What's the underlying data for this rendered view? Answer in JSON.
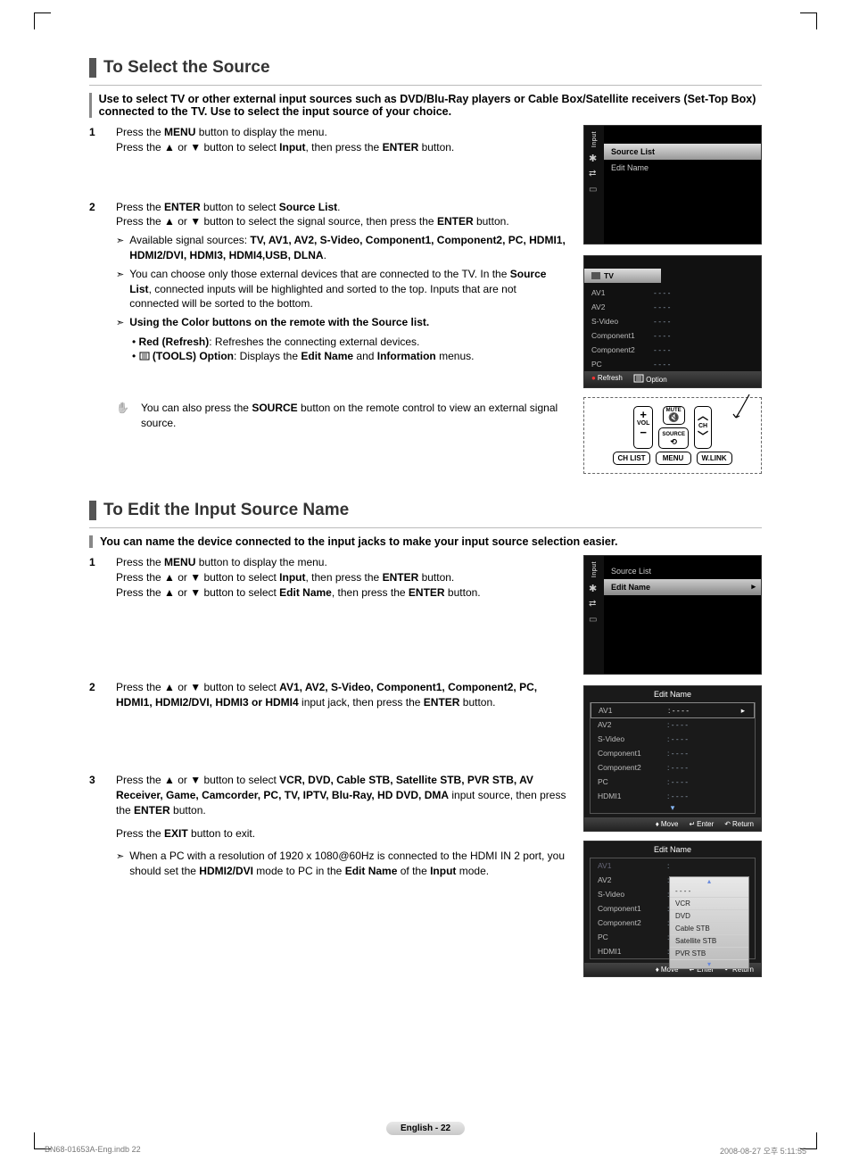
{
  "section1": {
    "heading": "To Select the Source",
    "intro": "Use to select TV or other external input sources such as DVD/Blu-Ray players or Cable Box/Satellite receivers (Set-Top Box) connected to the TV. Use to select the input source of your choice.",
    "step1_a": "Press the ",
    "step1_menu": "MENU",
    "step1_b": " button to display the menu.",
    "step1_c": "Press the ▲ or ▼ button to select ",
    "step1_input": "Input",
    "step1_d": ", then press the ",
    "step1_enter": "ENTER",
    "step1_e": " button.",
    "step2_a": "Press the ",
    "step2_enter1": "ENTER",
    "step2_b": " button to select ",
    "step2_sl": "Source List",
    "step2_c": ".",
    "step2_d": "Press the ▲ or ▼ button to select the signal source, then press the ",
    "step2_enter2": "ENTER",
    "step2_e": " button.",
    "arrow1_a": "Available signal sources: ",
    "arrow1_sources": "TV, AV1, AV2, S-Video, Component1, Component2, PC, HDMI1, HDMI2/DVI, HDMI3, HDMI4,USB, DLNA",
    "arrow1_b": ".",
    "arrow2_a": "You can choose only those external devices that are connected to the TV. In the ",
    "arrow2_sl": "Source List",
    "arrow2_b": ", connected inputs will be highlighted and sorted to the top. Inputs that are not connected will be sorted to the bottom.",
    "arrow3": "Using the Color buttons on the remote with the Source list.",
    "sub_red_label": "Red (Refresh)",
    "sub_red_text": ": Refreshes the connecting external devices.",
    "sub_tools_label": "(TOOLS) Option",
    "sub_tools_a": ": Displays the ",
    "sub_tools_edit": "Edit Name",
    "sub_tools_b": " and ",
    "sub_tools_info": "Information",
    "sub_tools_c": " menus.",
    "note_a": "You can also press the ",
    "note_src": "SOURCE",
    "note_b": " button on the remote control to view an external signal source."
  },
  "section2": {
    "heading": "To Edit the Input Source Name",
    "intro": "You can name the device connected to the input jacks to make your input source selection easier.",
    "step1_a": "Press the ",
    "step1_menu": "MENU",
    "step1_b": " button to display the menu.",
    "step1_c": "Press the ▲ or ▼ button to select ",
    "step1_input": "Input",
    "step1_d": ", then press the ",
    "step1_enter": "ENTER",
    "step1_e": " button.",
    "step1_f": "Press the ▲ or ▼ button to select ",
    "step1_edit": "Edit Name",
    "step1_g": ", then press the ",
    "step1_enter2": "ENTER",
    "step1_h": " button.",
    "step2_a": "Press the ▲ or ▼ button to select ",
    "step2_list": "AV1, AV2, S-Video, Component1, Component2, PC, HDMI1, HDMI2/DVI, HDMI3 or HDMI4",
    "step2_b": " input jack, then press the ",
    "step2_enter": "ENTER",
    "step2_c": " button.",
    "step3_a": "Press the ▲ or ▼ button to select ",
    "step3_list": "VCR, DVD, Cable STB, Satellite STB, PVR STB, AV Receiver, Game, Camcorder, PC, TV, IPTV, Blu-Ray, HD DVD, DMA",
    "step3_b": " input source, then press the ",
    "step3_enter": "ENTER",
    "step3_c": " button.",
    "step3_d": "Press the ",
    "step3_exit": "EXIT",
    "step3_e": " button to exit.",
    "arrow_a": "When a PC with a resolution of 1920 x 1080@60Hz is connected to the HDMI IN 2 port, you should set the ",
    "arrow_hdmi": "HDMI2/DVI",
    "arrow_b": " mode to PC in the ",
    "arrow_edit": "Edit Name",
    "arrow_c": " of the ",
    "arrow_input": "Input",
    "arrow_d": " mode."
  },
  "osd1": {
    "side_label": "Input",
    "row_sel": "Source List",
    "row_plain": "Edit Name"
  },
  "osd_srclist": {
    "tv": "TV",
    "rows": [
      "AV1",
      "AV2",
      "S-Video",
      "Component1",
      "Component2",
      "PC"
    ],
    "dash": "- - - -",
    "refresh": "Refresh",
    "option": "Option"
  },
  "remote": {
    "mute": "MUTE",
    "vol": "VOL",
    "source": "SOURCE",
    "ch": "CH",
    "chlist": "CH LIST",
    "menu": "MENU",
    "wlink": "W.LINK"
  },
  "osd_edit1": {
    "side_label": "Input",
    "row_plain": "Source List",
    "row_sel": "Edit Name"
  },
  "osd_panel_editA": {
    "title": "Edit Name",
    "rows": [
      "AV1",
      "AV2",
      "S-Video",
      "Component1",
      "Component2",
      "PC",
      "HDMI1"
    ],
    "dash": ": - - - -",
    "move": "Move",
    "enter": "Enter",
    "ret": "Return"
  },
  "osd_panel_editB": {
    "title": "Edit Name",
    "left_rows": [
      "AV1",
      "AV2",
      "S-Video",
      "Component1",
      "Component2",
      "PC",
      "HDMI1"
    ],
    "col": ":",
    "popup_blank": "- - - -",
    "popup": [
      "VCR",
      "DVD",
      "Cable STB",
      "Satellite STB",
      "PVR STB"
    ],
    "move": "Move",
    "enter": "Enter",
    "ret": "Return"
  },
  "footer": {
    "chip": "English - 22",
    "file": "BN68-01653A-Eng.indb   22",
    "time": "2008-08-27   오후 5:11:55"
  }
}
